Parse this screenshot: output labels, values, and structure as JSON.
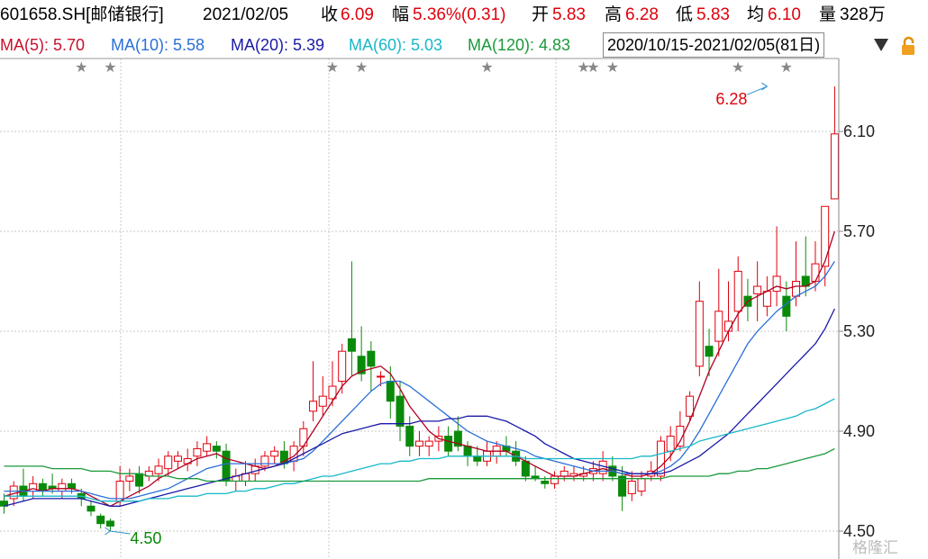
{
  "header": {
    "code": "601658.SH[邮储银行]",
    "date": "2021/02/05",
    "close_label": "收",
    "close_value": "6.09",
    "change_label": "幅",
    "change_value": "5.36%(0.31)",
    "open_label": "开",
    "open_value": "5.83",
    "high_label": "高",
    "high_value": "6.28",
    "low_label": "低",
    "low_value": "5.83",
    "avg_label": "均",
    "avg_value": "6.10",
    "vol_label": "量",
    "vol_value": "328万"
  },
  "ma_bar": {
    "ma5": "MA(5): 5.70",
    "ma10": "MA(10): 5.58",
    "ma20": "MA(20): 5.39",
    "ma60": "MA(60): 5.03",
    "ma120": "MA(120): 4.83",
    "range": "2020/10/15-2021/02/05(81日)",
    "dropdown_icon": "chevron-down-icon",
    "lock_icon": "lock-icon"
  },
  "colors": {
    "up": "#e0000d",
    "down": "#0a8a0a",
    "ma5": "#b00020",
    "ma10": "#2a6fd8",
    "ma20": "#1a1aa8",
    "ma60": "#17b8c8",
    "ma120": "#1a9a3a",
    "grid": "#c8c8c8"
  },
  "watermark": "格隆汇",
  "chart_data": {
    "type": "candlestick",
    "ylim": [
      4.45,
      6.35
    ],
    "yticks": [
      "6.10",
      "5.70",
      "5.30",
      "4.90",
      "4.50"
    ],
    "grid": true,
    "annotations": [
      {
        "text": "6.28",
        "candle": 79,
        "value": 6.28
      },
      {
        "text": "4.50",
        "candle": 11,
        "value": 4.5
      }
    ],
    "event_star_candles": [
      8,
      11,
      34,
      37,
      50,
      60,
      61,
      63,
      76,
      81
    ],
    "event_star_glyph": "★",
    "ohlc": [
      [
        4.62,
        4.65,
        4.57,
        4.6
      ],
      [
        4.63,
        4.7,
        4.6,
        4.68
      ],
      [
        4.68,
        4.75,
        4.62,
        4.64
      ],
      [
        4.66,
        4.72,
        4.63,
        4.69
      ],
      [
        4.69,
        4.71,
        4.64,
        4.66
      ],
      [
        4.68,
        4.73,
        4.65,
        4.67
      ],
      [
        4.66,
        4.71,
        4.63,
        4.69
      ],
      [
        4.69,
        4.71,
        4.65,
        4.67
      ],
      [
        4.65,
        4.67,
        4.6,
        4.63
      ],
      [
        4.6,
        4.62,
        4.56,
        4.58
      ],
      [
        4.56,
        4.57,
        4.51,
        4.53
      ],
      [
        4.54,
        4.55,
        4.5,
        4.52
      ],
      [
        4.62,
        4.76,
        4.6,
        4.7
      ],
      [
        4.7,
        4.75,
        4.66,
        4.72
      ],
      [
        4.73,
        4.76,
        4.65,
        4.68
      ],
      [
        4.72,
        4.76,
        4.7,
        4.74
      ],
      [
        4.73,
        4.79,
        4.7,
        4.76
      ],
      [
        4.75,
        4.82,
        4.72,
        4.8
      ],
      [
        4.78,
        4.82,
        4.75,
        4.8
      ],
      [
        4.77,
        4.83,
        4.74,
        4.79
      ],
      [
        4.8,
        4.86,
        4.76,
        4.83
      ],
      [
        4.82,
        4.88,
        4.8,
        4.85
      ],
      [
        4.84,
        4.86,
        4.79,
        4.82
      ],
      [
        4.82,
        4.85,
        4.68,
        4.7
      ],
      [
        4.7,
        4.75,
        4.66,
        4.72
      ],
      [
        4.7,
        4.78,
        4.68,
        4.73
      ],
      [
        4.73,
        4.79,
        4.7,
        4.76
      ],
      [
        4.76,
        4.82,
        4.74,
        4.8
      ],
      [
        4.8,
        4.84,
        4.77,
        4.82
      ],
      [
        4.82,
        4.86,
        4.75,
        4.77
      ],
      [
        4.78,
        4.86,
        4.74,
        4.84
      ],
      [
        4.84,
        4.94,
        4.8,
        4.91
      ],
      [
        4.98,
        5.18,
        4.94,
        5.02
      ],
      [
        5.0,
        5.12,
        4.96,
        5.04
      ],
      [
        5.03,
        5.18,
        5.0,
        5.08
      ],
      [
        5.1,
        5.25,
        5.05,
        5.22
      ],
      [
        5.27,
        5.58,
        5.12,
        5.22
      ],
      [
        5.2,
        5.32,
        5.1,
        5.13
      ],
      [
        5.22,
        5.26,
        5.06,
        5.16
      ],
      [
        5.12,
        5.14,
        5.08,
        5.12
      ],
      [
        5.1,
        5.16,
        4.95,
        5.02
      ],
      [
        5.04,
        5.1,
        4.86,
        4.92
      ],
      [
        4.92,
        4.96,
        4.8,
        4.84
      ],
      [
        4.84,
        4.9,
        4.8,
        4.86
      ],
      [
        4.84,
        4.88,
        4.8,
        4.86
      ],
      [
        4.86,
        4.92,
        4.82,
        4.88
      ],
      [
        4.88,
        4.92,
        4.8,
        4.82
      ],
      [
        4.9,
        4.96,
        4.82,
        4.84
      ],
      [
        4.84,
        4.86,
        4.76,
        4.8
      ],
      [
        4.8,
        4.84,
        4.76,
        4.78
      ],
      [
        4.78,
        4.86,
        4.76,
        4.82
      ],
      [
        4.8,
        4.86,
        4.77,
        4.84
      ],
      [
        4.84,
        4.88,
        4.8,
        4.82
      ],
      [
        4.82,
        4.86,
        4.76,
        4.78
      ],
      [
        4.78,
        4.8,
        4.7,
        4.72
      ],
      [
        4.72,
        4.76,
        4.7,
        4.71
      ],
      [
        4.7,
        4.72,
        4.67,
        4.69
      ],
      [
        4.69,
        4.74,
        4.67,
        4.72
      ],
      [
        4.72,
        4.76,
        4.7,
        4.74
      ],
      [
        4.72,
        4.76,
        4.7,
        4.73
      ],
      [
        4.72,
        4.76,
        4.7,
        4.73
      ],
      [
        4.73,
        4.78,
        4.7,
        4.75
      ],
      [
        4.73,
        4.82,
        4.7,
        4.78
      ],
      [
        4.76,
        4.8,
        4.7,
        4.72
      ],
      [
        4.72,
        4.76,
        4.58,
        4.64
      ],
      [
        4.65,
        4.74,
        4.62,
        4.7
      ],
      [
        4.66,
        4.74,
        4.64,
        4.71
      ],
      [
        4.72,
        4.78,
        4.7,
        4.74
      ],
      [
        4.72,
        4.88,
        4.7,
        4.86
      ],
      [
        4.82,
        4.92,
        4.78,
        4.88
      ],
      [
        4.84,
        4.98,
        4.82,
        4.92
      ],
      [
        4.96,
        5.06,
        4.94,
        5.04
      ],
      [
        5.16,
        5.5,
        5.12,
        5.42
      ],
      [
        5.24,
        5.31,
        5.12,
        5.2
      ],
      [
        5.26,
        5.55,
        5.2,
        5.38
      ],
      [
        5.3,
        5.5,
        5.26,
        5.34
      ],
      [
        5.38,
        5.6,
        5.3,
        5.54
      ],
      [
        5.44,
        5.51,
        5.34,
        5.4
      ],
      [
        5.45,
        5.58,
        5.34,
        5.48
      ],
      [
        5.4,
        5.52,
        5.36,
        5.46
      ],
      [
        5.46,
        5.72,
        5.4,
        5.52
      ],
      [
        5.44,
        5.5,
        5.3,
        5.36
      ],
      [
        5.44,
        5.66,
        5.4,
        5.5
      ],
      [
        5.52,
        5.68,
        5.44,
        5.48
      ],
      [
        5.5,
        5.66,
        5.46,
        5.57
      ],
      [
        5.56,
        5.7,
        5.48,
        5.8
      ],
      [
        5.83,
        6.28,
        5.83,
        6.09
      ]
    ],
    "series": [
      {
        "name": "MA(5)",
        "color_key": "ma5",
        "values": [
          4.64,
          4.65,
          4.66,
          4.67,
          4.66,
          4.67,
          4.67,
          4.67,
          4.66,
          4.64,
          4.62,
          4.6,
          4.62,
          4.64,
          4.66,
          4.68,
          4.71,
          4.73,
          4.75,
          4.77,
          4.79,
          4.8,
          4.81,
          4.79,
          4.78,
          4.77,
          4.76,
          4.75,
          4.76,
          4.78,
          4.8,
          4.84,
          4.9,
          4.96,
          5.02,
          5.08,
          5.12,
          5.14,
          5.15,
          5.16,
          5.13,
          5.07,
          5.0,
          4.95,
          4.9,
          4.87,
          4.86,
          4.85,
          4.84,
          4.83,
          4.82,
          4.82,
          4.82,
          4.8,
          4.78,
          4.76,
          4.74,
          4.72,
          4.72,
          4.72,
          4.73,
          4.74,
          4.75,
          4.74,
          4.73,
          4.72,
          4.72,
          4.73,
          4.76,
          4.8,
          4.86,
          4.94,
          5.04,
          5.14,
          5.22,
          5.3,
          5.37,
          5.42,
          5.44,
          5.46,
          5.48,
          5.47,
          5.48,
          5.48,
          5.5,
          5.58,
          5.7
        ]
      },
      {
        "name": "MA(10)",
        "color_key": "ma10",
        "values": [
          4.66,
          4.66,
          4.66,
          4.66,
          4.66,
          4.66,
          4.66,
          4.66,
          4.66,
          4.65,
          4.64,
          4.63,
          4.63,
          4.63,
          4.64,
          4.65,
          4.66,
          4.67,
          4.69,
          4.71,
          4.73,
          4.75,
          4.76,
          4.77,
          4.77,
          4.77,
          4.77,
          4.77,
          4.77,
          4.77,
          4.78,
          4.79,
          4.82,
          4.86,
          4.9,
          4.94,
          4.98,
          5.02,
          5.06,
          5.09,
          5.1,
          5.1,
          5.08,
          5.05,
          5.02,
          4.99,
          4.96,
          4.93,
          4.9,
          4.88,
          4.86,
          4.85,
          4.84,
          4.83,
          4.82,
          4.8,
          4.79,
          4.78,
          4.77,
          4.76,
          4.75,
          4.74,
          4.74,
          4.74,
          4.73,
          4.73,
          4.73,
          4.73,
          4.74,
          4.76,
          4.79,
          4.84,
          4.9,
          4.97,
          5.04,
          5.11,
          5.18,
          5.25,
          5.3,
          5.34,
          5.38,
          5.41,
          5.44,
          5.46,
          5.48,
          5.52,
          5.58
        ]
      },
      {
        "name": "MA(20)",
        "color_key": "ma20",
        "values": [
          4.6,
          4.61,
          4.62,
          4.63,
          4.63,
          4.63,
          4.63,
          4.63,
          4.63,
          4.62,
          4.61,
          4.6,
          4.6,
          4.61,
          4.62,
          4.63,
          4.64,
          4.65,
          4.66,
          4.67,
          4.68,
          4.69,
          4.7,
          4.71,
          4.72,
          4.73,
          4.74,
          4.75,
          4.76,
          4.77,
          4.79,
          4.81,
          4.83,
          4.85,
          4.87,
          4.89,
          4.9,
          4.91,
          4.92,
          4.93,
          4.93,
          4.93,
          4.93,
          4.94,
          4.94,
          4.94,
          4.95,
          4.95,
          4.96,
          4.96,
          4.96,
          4.95,
          4.94,
          4.92,
          4.9,
          4.88,
          4.85,
          4.83,
          4.81,
          4.79,
          4.78,
          4.77,
          4.76,
          4.75,
          4.74,
          4.73,
          4.73,
          4.73,
          4.73,
          4.74,
          4.76,
          4.78,
          4.8,
          4.83,
          4.86,
          4.89,
          4.93,
          4.97,
          5.01,
          5.05,
          5.09,
          5.13,
          5.17,
          5.21,
          5.25,
          5.31,
          5.39
        ]
      },
      {
        "name": "MA(60)",
        "color_key": "ma60",
        "values": [
          4.64,
          4.64,
          4.64,
          4.64,
          4.64,
          4.64,
          4.64,
          4.64,
          4.64,
          4.63,
          4.62,
          4.62,
          4.62,
          4.62,
          4.62,
          4.63,
          4.63,
          4.63,
          4.64,
          4.64,
          4.64,
          4.65,
          4.65,
          4.65,
          4.66,
          4.66,
          4.67,
          4.67,
          4.68,
          4.69,
          4.69,
          4.7,
          4.71,
          4.72,
          4.72,
          4.73,
          4.74,
          4.75,
          4.76,
          4.77,
          4.77,
          4.78,
          4.78,
          4.79,
          4.79,
          4.79,
          4.8,
          4.8,
          4.8,
          4.8,
          4.8,
          4.8,
          4.8,
          4.8,
          4.79,
          4.79,
          4.79,
          4.79,
          4.79,
          4.79,
          4.79,
          4.79,
          4.79,
          4.79,
          4.79,
          4.79,
          4.8,
          4.8,
          4.81,
          4.82,
          4.83,
          4.84,
          4.86,
          4.87,
          4.88,
          4.89,
          4.9,
          4.91,
          4.92,
          4.93,
          4.94,
          4.95,
          4.96,
          4.98,
          4.99,
          5.01,
          5.03
        ]
      },
      {
        "name": "MA(120)",
        "color_key": "ma120",
        "values": [
          4.76,
          4.76,
          4.76,
          4.76,
          4.76,
          4.75,
          4.75,
          4.75,
          4.75,
          4.74,
          4.74,
          4.74,
          4.73,
          4.73,
          4.73,
          4.72,
          4.72,
          4.72,
          4.71,
          4.71,
          4.71,
          4.7,
          4.7,
          4.7,
          4.7,
          4.7,
          4.7,
          4.7,
          4.7,
          4.7,
          4.7,
          4.7,
          4.7,
          4.7,
          4.7,
          4.7,
          4.7,
          4.7,
          4.7,
          4.7,
          4.7,
          4.7,
          4.7,
          4.7,
          4.71,
          4.71,
          4.71,
          4.71,
          4.71,
          4.71,
          4.71,
          4.71,
          4.71,
          4.71,
          4.71,
          4.71,
          4.71,
          4.71,
          4.71,
          4.71,
          4.71,
          4.71,
          4.71,
          4.71,
          4.71,
          4.71,
          4.71,
          4.71,
          4.71,
          4.72,
          4.72,
          4.72,
          4.72,
          4.72,
          4.73,
          4.73,
          4.74,
          4.74,
          4.75,
          4.75,
          4.76,
          4.77,
          4.78,
          4.79,
          4.8,
          4.81,
          4.83
        ]
      }
    ]
  }
}
